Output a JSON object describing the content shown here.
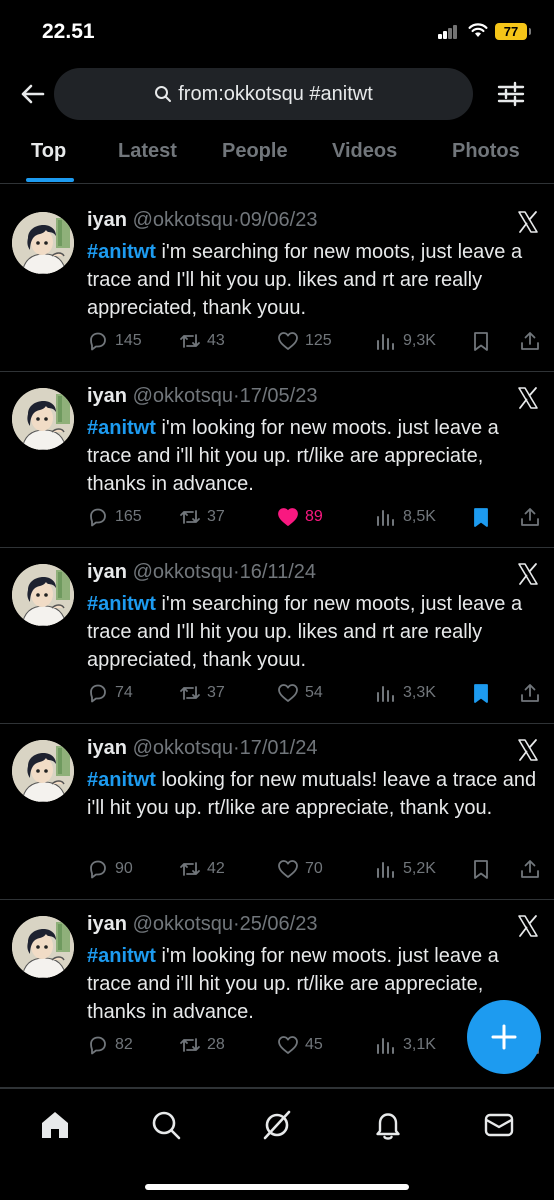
{
  "status_bar": {
    "time": "22.51",
    "battery": "77"
  },
  "search": {
    "query": "from:okkotsqu #anitwt"
  },
  "tabs": [
    {
      "label": "Top",
      "active": true
    },
    {
      "label": "Latest",
      "active": false
    },
    {
      "label": "People",
      "active": false
    },
    {
      "label": "Videos",
      "active": false
    },
    {
      "label": "Photos",
      "active": false
    }
  ],
  "tweets": [
    {
      "name": "iyan",
      "handle": "@okkotsqu",
      "sep": "·",
      "date": "09/06/23",
      "hashtag": "#anitwt",
      "text": " i'm searching for new moots, just leave a trace and I'll hit you up. likes and rt are really appreciated, thank youu.",
      "replies": "145",
      "retweets": "43",
      "likes": "125",
      "views": "9,3K",
      "liked": false,
      "bookmarked": false
    },
    {
      "name": "iyan",
      "handle": "@okkotsqu",
      "sep": "·",
      "date": "17/05/23",
      "hashtag": "#anitwt",
      "text": " i'm looking for new moots. just leave a trace and i'll hit you up. rt/like are appreciate, thanks in advance.",
      "replies": "165",
      "retweets": "37",
      "likes": "89",
      "views": "8,5K",
      "liked": true,
      "bookmarked": true
    },
    {
      "name": "iyan",
      "handle": "@okkotsqu",
      "sep": "·",
      "date": "16/11/24",
      "hashtag": "#anitwt",
      "text": " i'm searching for new moots, just leave a trace and I'll hit you up. likes and rt are really appreciated, thank youu.",
      "replies": "74",
      "retweets": "37",
      "likes": "54",
      "views": "3,3K",
      "liked": false,
      "bookmarked": true
    },
    {
      "name": "iyan",
      "handle": "@okkotsqu",
      "sep": "·",
      "date": "17/01/24",
      "hashtag": "#anitwt",
      "text": " looking for new mutuals! leave a trace and i'll hit you up. rt/like are appreciate, thank you.",
      "replies": "90",
      "retweets": "42",
      "likes": "70",
      "views": "5,2K",
      "liked": false,
      "bookmarked": false
    },
    {
      "name": "iyan",
      "handle": "@okkotsqu",
      "sep": "·",
      "date": "25/06/23",
      "hashtag": "#anitwt",
      "text": " i'm looking for new moots. just leave a trace and i'll hit you up. rt/like are appreciate, thanks in advance.",
      "replies": "82",
      "retweets": "28",
      "likes": "45",
      "views": "3,1K",
      "liked": false,
      "bookmarked": false
    }
  ],
  "colors": {
    "accent": "#1d9bf0",
    "like": "#f91880",
    "muted": "#71767b",
    "background": "#000000"
  },
  "bottom_nav": [
    "home-icon",
    "search-icon",
    "grok-icon",
    "notifications-icon",
    "messages-icon"
  ]
}
